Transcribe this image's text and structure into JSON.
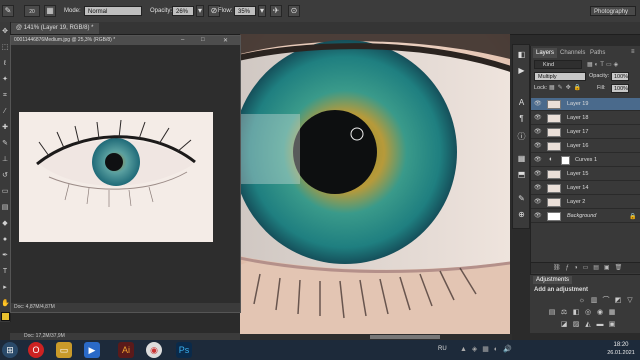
{
  "options_bar": {
    "mode_label": "Mode:",
    "mode_value": "Normal",
    "opacity_label": "Opacity:",
    "opacity_value": "26%",
    "flow_label": "Flow:",
    "flow_value": "35%",
    "brush_size": "20",
    "workspace": "Photography"
  },
  "tabs": [
    {
      "label": "@ 141% (Layer 19, RGB/8) *"
    }
  ],
  "float_window": {
    "title": "00011446876Medium.jpg @ 25,3% (RGB/8) *",
    "status": "Doc: 4,87M/4,87M"
  },
  "main_status": "Doc: 17,2M/37,9M",
  "layers_panel": {
    "tabs": [
      "Layers",
      "Channels",
      "Paths"
    ],
    "kind_label": "Kind",
    "blend_mode": "Multiply",
    "opacity_label": "Opacity:",
    "opacity_value": "100%",
    "lock_label": "Lock:",
    "fill_label": "Fill:",
    "fill_value": "100%",
    "layers": [
      {
        "name": "Layer 19",
        "selected": true
      },
      {
        "name": "Layer 18",
        "selected": false
      },
      {
        "name": "Layer 17",
        "selected": false
      },
      {
        "name": "Layer 16",
        "selected": false
      },
      {
        "name": "Curves 1",
        "selected": false
      },
      {
        "name": "Layer 15",
        "selected": false
      },
      {
        "name": "Layer 14",
        "selected": false
      },
      {
        "name": "Layer 2",
        "selected": false
      },
      {
        "name": "Background",
        "selected": false
      }
    ]
  },
  "adjustments_panel": {
    "title": "Adjustments",
    "subtitle": "Add an adjustment"
  },
  "taskbar": {
    "language": "RU",
    "time": "18:20",
    "date": "26.01.2021"
  },
  "colors": {
    "panel_bg": "#393939",
    "selection": "#4a6a8c",
    "iris_teal": "#2a8a8a"
  }
}
